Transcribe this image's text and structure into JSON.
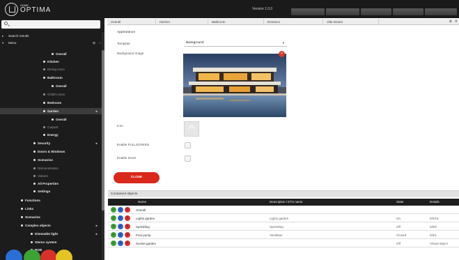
{
  "header": {
    "brand_small": "HOME",
    "brand_big": "OPTIMA",
    "version": "Version 1.0.0",
    "buttons": [
      "",
      "",
      "",
      "",
      ""
    ]
  },
  "sidebar": {
    "search_placeholder": "",
    "items": [
      {
        "label": "Search results"
      },
      {
        "label": "Menu"
      },
      {
        "label": "Overall"
      },
      {
        "label": "Kitchen"
      },
      {
        "label": "Dining room"
      },
      {
        "label": "Bathroom"
      },
      {
        "label": "Overall"
      },
      {
        "label": "Child's room"
      },
      {
        "label": "Bedroom"
      },
      {
        "label": "Garden"
      },
      {
        "label": "Overall"
      },
      {
        "label": "Carport"
      },
      {
        "label": "Energy"
      },
      {
        "label": "Security"
      },
      {
        "label": "Doors & Windows"
      },
      {
        "label": "Scenarios"
      },
      {
        "label": "Demonstration"
      },
      {
        "label": "Visitors"
      },
      {
        "label": "All Properties"
      },
      {
        "label": "Settings"
      },
      {
        "label": "Functions"
      },
      {
        "label": "Links"
      },
      {
        "label": "Scenarios"
      },
      {
        "label": "Complex objects"
      },
      {
        "label": "Dimmable light"
      },
      {
        "label": "Stereo system"
      },
      {
        "label": "RGB"
      }
    ],
    "circle_colors": [
      "#2a6fd6",
      "#3ea335",
      "#d6312a",
      "#e2c424"
    ]
  },
  "tabs": [
    "Overall",
    "Kitchen",
    "Bathroom",
    "Entrance",
    "Villa Dream"
  ],
  "form": {
    "section": "Appearance",
    "template_label": "Template",
    "template_value": "Background",
    "bg_image_label": "Background image",
    "icon_label": "Icon",
    "enable_fullscreen_label": "Enable FULLSCREEN",
    "enable_zoom_label": "Enable Zoom",
    "close_label": "CLOSE"
  },
  "table": {
    "title": "Contained objects",
    "columns": [
      "Name",
      "Description / ETS name",
      "State",
      "Details"
    ],
    "rows": [
      {
        "name": "Overall",
        "desc": "",
        "state": "",
        "details": ""
      },
      {
        "name": "Lights garden",
        "desc": "Lights garden",
        "state": "On",
        "details": "0/0/16"
      },
      {
        "name": "Sprinkling",
        "desc": "Sprinkling",
        "state": "Off",
        "details": "0/0/0"
      },
      {
        "name": "Pool pump",
        "desc": "Ventilator",
        "state": "Closed",
        "details": "0/0/1"
      },
      {
        "name": "Socket garden",
        "desc": "",
        "state": "Off",
        "details": "Virtual object"
      }
    ]
  },
  "colors": {
    "accent_red": "#d8291b",
    "status_green": "#3ea335",
    "status_blue": "#2e63c9",
    "status_red": "#d6312a"
  }
}
